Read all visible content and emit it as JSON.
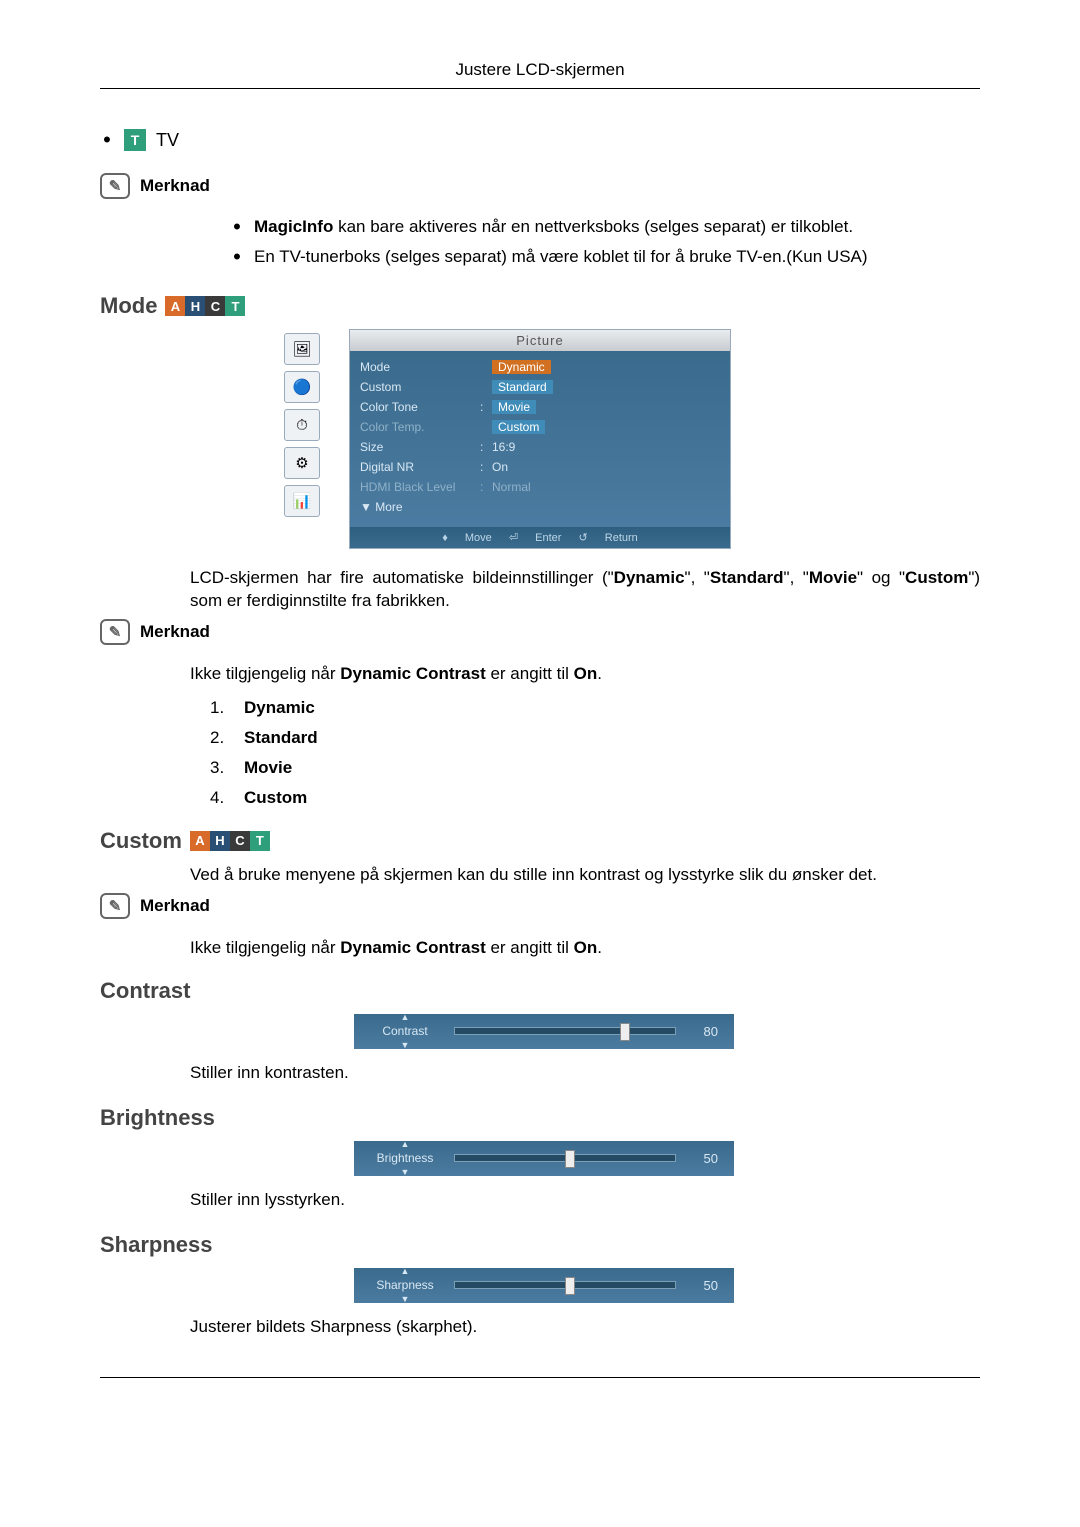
{
  "header": "Justere LCD-skjermen",
  "tv": {
    "label": "TV",
    "icon_letter": "T"
  },
  "merknad_label": "Merknad",
  "merknad1_bullets": [
    {
      "pre": "",
      "bold1": "MagicInfo",
      "post1": " kan bare aktiveres når en nettverksboks (selges separat) er tilkoblet."
    },
    {
      "pre": "En TV-tunerboks (selges separat) må være koblet til for å bruke TV-en.(Kun USA)",
      "bold1": "",
      "post1": ""
    }
  ],
  "mode": {
    "title": "Mode",
    "ahct": {
      "a": "A",
      "h": "H",
      "c": "C",
      "t": "T"
    },
    "osd_title": "Picture",
    "icons": [
      "🖼",
      "🔵",
      "⏱",
      "⚙",
      "📊"
    ],
    "items": [
      {
        "label": "Mode",
        "val": "Dynamic",
        "hl": "orange"
      },
      {
        "label": "Custom",
        "val": "Standard",
        "hl": "blue"
      },
      {
        "label": "Color Tone",
        "val": "Movie",
        "hl": "blue",
        "colon": ":"
      },
      {
        "label": "Color Temp.",
        "val": "Custom",
        "hl": "blue",
        "dim": true
      },
      {
        "label": "Size",
        "val": "16:9",
        "colon": ":"
      },
      {
        "label": "Digital NR",
        "val": "On",
        "colon": ":"
      },
      {
        "label": "HDMI Black Level",
        "val": "Normal",
        "colon": ":",
        "dim": true
      },
      {
        "label": "▼ More",
        "val": ""
      }
    ],
    "foot": {
      "move": "♦ Move",
      "enter": "⏎ Enter",
      "return": "↺ Return"
    },
    "para_pre": "LCD-skjermen har fire automatiske bildeinnstillinger (\"",
    "para_b1": "Dynamic",
    "para_m1": "\", \"",
    "para_b2": "Standard",
    "para_m2": "\", \"",
    "para_b3": "Movie",
    "para_m3": "\" og \"",
    "para_b4": "Custom",
    "para_post": "\") som er ferdiginnstilte fra fabrikken.",
    "note2_pre": "Ikke tilgjengelig når ",
    "note2_b": "Dynamic Contrast",
    "note2_m": " er angitt til ",
    "note2_b2": "On",
    "note2_post": ".",
    "list": [
      "Dynamic",
      "Standard",
      "Movie",
      "Custom"
    ]
  },
  "custom": {
    "title": "Custom",
    "para": "Ved å bruke menyene på skjermen kan du stille inn kontrast og lysstyrke slik du ønsker det.",
    "note_pre": "Ikke tilgjengelig når ",
    "note_b": "Dynamic Contrast",
    "note_m": " er angitt til ",
    "note_b2": "On",
    "note_post": "."
  },
  "contrast": {
    "title": "Contrast",
    "label": "Contrast",
    "value": "80",
    "pos": 75,
    "desc": "Stiller inn kontrasten."
  },
  "brightness": {
    "title": "Brightness",
    "label": "Brightness",
    "value": "50",
    "pos": 50,
    "desc": "Stiller inn lysstyrken."
  },
  "sharpness": {
    "title": "Sharpness",
    "label": "Sharpness",
    "value": "50",
    "pos": 50,
    "desc": "Justerer bildets Sharpness (skarphet)."
  }
}
